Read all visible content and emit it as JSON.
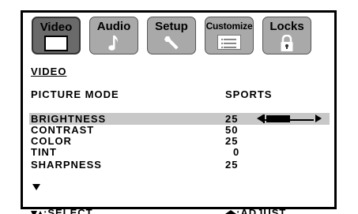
{
  "tabs": [
    {
      "label": "Video",
      "icon": "video-screen-icon",
      "active": true
    },
    {
      "label": "Audio",
      "icon": "music-note-icon",
      "active": false
    },
    {
      "label": "Setup",
      "icon": "wrench-icon",
      "active": false
    },
    {
      "label": "Customize",
      "icon": "list-icon",
      "active": false
    },
    {
      "label": "Locks",
      "icon": "padlock-icon",
      "active": false
    }
  ],
  "section_title": "VIDEO",
  "picture_mode": {
    "label": "PICTURE MODE",
    "value": "SPORTS"
  },
  "settings": [
    {
      "label": "BRIGHTNESS",
      "value": "25",
      "selected": true,
      "slider_level": 0.5
    },
    {
      "label": "CONTRAST",
      "value": "50"
    },
    {
      "label": "COLOR",
      "value": "25"
    },
    {
      "label": "TINT",
      "value": "0"
    },
    {
      "label": "SHARPNESS",
      "value": "25"
    }
  ],
  "footer": {
    "select_label": ":SELECT",
    "adjust_label": ":ADJUST"
  },
  "colors": {
    "active_tab": "#6a6a6a",
    "inactive_tab": "#a9a9a9",
    "highlight_row": "#c8c8c8"
  }
}
